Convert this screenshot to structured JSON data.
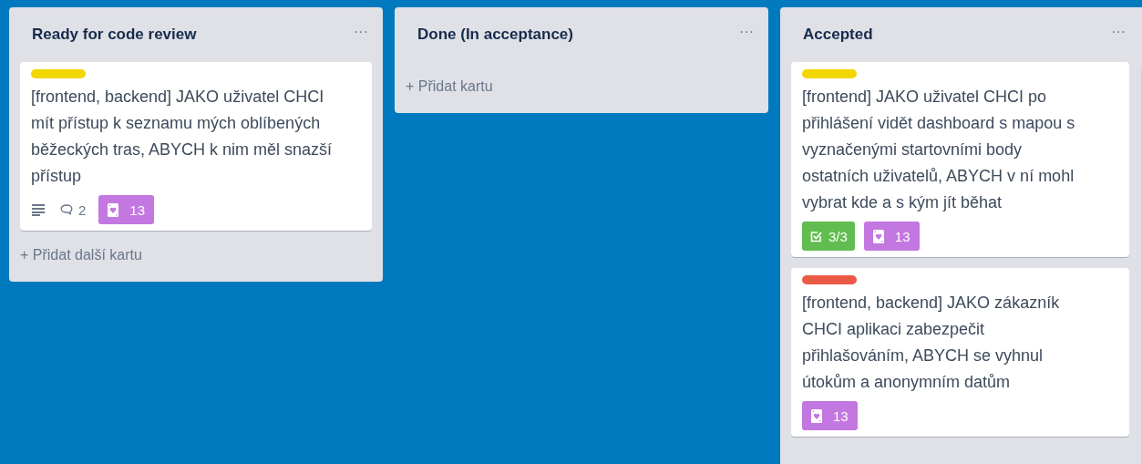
{
  "lists": [
    {
      "title": "Ready for code review",
      "menu": "···",
      "cards": [
        {
          "color": "#f2d600",
          "text": "[frontend, backend] JAKO uživatel CHCI mít přístup k seznamu mých oblíbených běžeckých tras, ABYCH k nim měl snazší přístup",
          "badges": [
            {
              "kind": "description"
            },
            {
              "kind": "comments",
              "text": "2"
            },
            {
              "kind": "points",
              "text": "13"
            }
          ]
        }
      ],
      "add": "+ Přidat další kartu"
    },
    {
      "title": "Done (In acceptance)",
      "menu": "···",
      "add": "+ Přidat kartu"
    },
    {
      "title": "Accepted",
      "menu": "···",
      "cards": [
        {
          "color": "#f2d600",
          "text": "[frontend] JAKO uživatel CHCI po přihlášení vidět dashboard s mapou s vyznačenými startovními body ostatních uživatelů, ABYCH v ní mohl vybrat kde a s kým jít běhat",
          "badges": [
            {
              "kind": "checklist",
              "text": "3/3"
            },
            {
              "kind": "points",
              "text": "13"
            }
          ]
        },
        {
          "color": "#eb5a46",
          "text": "[frontend, backend] JAKO zákazník CHCI aplikaci zabezpečit přihlašováním, ABYCH se vyhnul útokům a anonymním datům",
          "badges": [
            {
              "kind": "points",
              "text": "13"
            }
          ]
        }
      ]
    }
  ]
}
